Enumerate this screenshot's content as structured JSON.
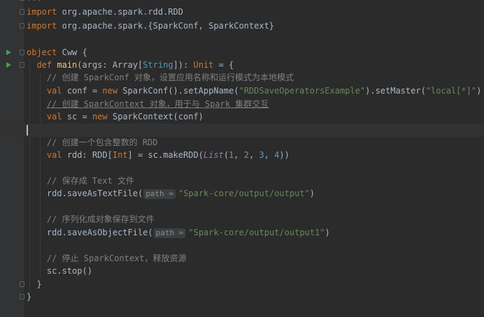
{
  "editor": {
    "top_fragment": "...",
    "imports": [
      {
        "keyword": "import",
        "path": "org.apache.spark.rdd.RDD"
      },
      {
        "keyword": "import",
        "path": "org.apache.spark.{SparkConf, SparkContext}"
      }
    ],
    "object_decl": {
      "keyword": "object",
      "name": "Cww",
      "brace": " {"
    },
    "main_decl": {
      "kw_def": "def",
      "name": "main",
      "params": "(args: Array[",
      "param_type": "String",
      "mid": "]): ",
      "ret_type": "Unit",
      "end": " = {"
    },
    "comment1": "// 创建 SparkConf 对象，设置应用名称和运行模式为本地模式",
    "conf_line": {
      "kw_val": "val",
      "lhs": " conf = ",
      "kw_new": "new",
      "call1": " SparkConf().",
      "fn1": "setAppName",
      "open1": "(",
      "str1": "\"RDDSaveOperatorsExample\"",
      "close1": ").",
      "fn2": "setMaster",
      "open2": "(",
      "str2": "\"local[*]\"",
      "close2": ")"
    },
    "comment2": "// 创建 SparkContext 对象，用于与 Spark 集群交互",
    "sc_line": {
      "kw_val": "val",
      "lhs": " sc = ",
      "kw_new": "new",
      "call": " SparkContext(conf)"
    },
    "comment3": "// 创建一个包含整数的 RDD",
    "rdd_line": {
      "kw_val": "val",
      "lhs": " rdd: RDD[",
      "type": "Int",
      "mid": "] = sc.makeRDD(",
      "list_fn": "List",
      "open": "(",
      "nums": [
        "1",
        "2",
        "3",
        "4"
      ],
      "sep": ", ",
      "close": "))"
    },
    "comment4": "// 保存成 Text 文件",
    "text_line": {
      "call": "rdd.saveAsTextFile(",
      "hint": "path =",
      "str": "\"Spark-core/output/output\"",
      "close": ")"
    },
    "comment5": "// 序列化成对象保存到文件",
    "obj_line": {
      "call": "rdd.saveAsObjectFile(",
      "hint": "path =",
      "str": "\"Spark-core/output/output1\"",
      "close": ")"
    },
    "comment6": "// 停止 SparkContext，释放资源",
    "stop_line": "sc.stop()",
    "close_inner": "}",
    "close_outer": "}"
  },
  "colors": {
    "background": "#2b2b2b",
    "keyword": "#cc7832",
    "function": "#ffc66d",
    "string": "#6a8759",
    "number": "#6897bb",
    "comment": "#808080",
    "run_icon": "#499c54"
  },
  "icons": [
    "run-icon",
    "fold-icon"
  ]
}
